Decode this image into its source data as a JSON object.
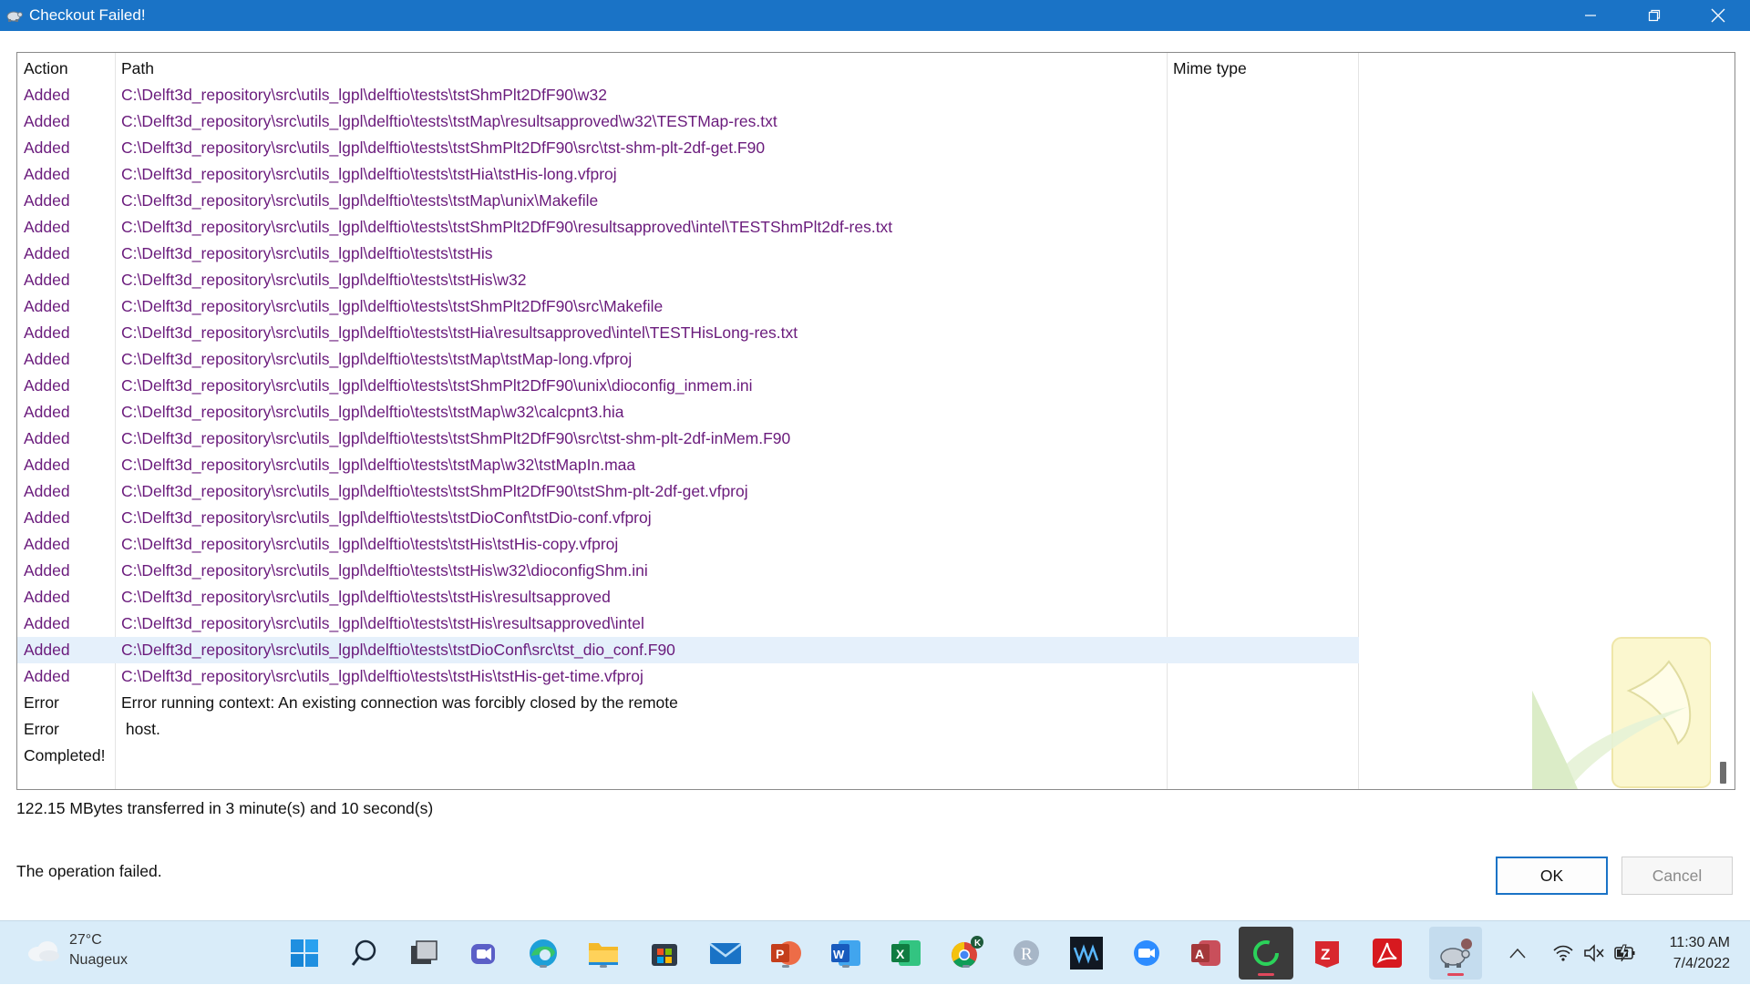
{
  "window": {
    "title": "Checkout Failed!",
    "accent": "#1a73c6"
  },
  "columns": {
    "action": "Action",
    "path": "Path",
    "mime": "Mime type"
  },
  "rows": [
    {
      "action": "Added",
      "path": "C:\\Delft3d_repository\\src\\utils_lgpl\\delftio\\tests\\tstShmPlt2DfF90\\w32"
    },
    {
      "action": "Added",
      "path": "C:\\Delft3d_repository\\src\\utils_lgpl\\delftio\\tests\\tstMap\\resultsapproved\\w32\\TESTMap-res.txt"
    },
    {
      "action": "Added",
      "path": "C:\\Delft3d_repository\\src\\utils_lgpl\\delftio\\tests\\tstShmPlt2DfF90\\src\\tst-shm-plt-2df-get.F90"
    },
    {
      "action": "Added",
      "path": "C:\\Delft3d_repository\\src\\utils_lgpl\\delftio\\tests\\tstHia\\tstHis-long.vfproj"
    },
    {
      "action": "Added",
      "path": "C:\\Delft3d_repository\\src\\utils_lgpl\\delftio\\tests\\tstMap\\unix\\Makefile"
    },
    {
      "action": "Added",
      "path": "C:\\Delft3d_repository\\src\\utils_lgpl\\delftio\\tests\\tstShmPlt2DfF90\\resultsapproved\\intel\\TESTShmPlt2df-res.txt"
    },
    {
      "action": "Added",
      "path": "C:\\Delft3d_repository\\src\\utils_lgpl\\delftio\\tests\\tstHis"
    },
    {
      "action": "Added",
      "path": "C:\\Delft3d_repository\\src\\utils_lgpl\\delftio\\tests\\tstHis\\w32"
    },
    {
      "action": "Added",
      "path": "C:\\Delft3d_repository\\src\\utils_lgpl\\delftio\\tests\\tstShmPlt2DfF90\\src\\Makefile"
    },
    {
      "action": "Added",
      "path": "C:\\Delft3d_repository\\src\\utils_lgpl\\delftio\\tests\\tstHia\\resultsapproved\\intel\\TESTHisLong-res.txt"
    },
    {
      "action": "Added",
      "path": "C:\\Delft3d_repository\\src\\utils_lgpl\\delftio\\tests\\tstMap\\tstMap-long.vfproj"
    },
    {
      "action": "Added",
      "path": "C:\\Delft3d_repository\\src\\utils_lgpl\\delftio\\tests\\tstShmPlt2DfF90\\unix\\dioconfig_inmem.ini"
    },
    {
      "action": "Added",
      "path": "C:\\Delft3d_repository\\src\\utils_lgpl\\delftio\\tests\\tstMap\\w32\\calcpnt3.hia"
    },
    {
      "action": "Added",
      "path": "C:\\Delft3d_repository\\src\\utils_lgpl\\delftio\\tests\\tstShmPlt2DfF90\\src\\tst-shm-plt-2df-inMem.F90"
    },
    {
      "action": "Added",
      "path": "C:\\Delft3d_repository\\src\\utils_lgpl\\delftio\\tests\\tstMap\\w32\\tstMapIn.maa"
    },
    {
      "action": "Added",
      "path": "C:\\Delft3d_repository\\src\\utils_lgpl\\delftio\\tests\\tstShmPlt2DfF90\\tstShm-plt-2df-get.vfproj"
    },
    {
      "action": "Added",
      "path": "C:\\Delft3d_repository\\src\\utils_lgpl\\delftio\\tests\\tstDioConf\\tstDio-conf.vfproj"
    },
    {
      "action": "Added",
      "path": "C:\\Delft3d_repository\\src\\utils_lgpl\\delftio\\tests\\tstHis\\tstHis-copy.vfproj"
    },
    {
      "action": "Added",
      "path": "C:\\Delft3d_repository\\src\\utils_lgpl\\delftio\\tests\\tstHis\\w32\\dioconfigShm.ini"
    },
    {
      "action": "Added",
      "path": "C:\\Delft3d_repository\\src\\utils_lgpl\\delftio\\tests\\tstHis\\resultsapproved"
    },
    {
      "action": "Added",
      "path": "C:\\Delft3d_repository\\src\\utils_lgpl\\delftio\\tests\\tstHis\\resultsapproved\\intel"
    },
    {
      "action": "Added",
      "path": "C:\\Delft3d_repository\\src\\utils_lgpl\\delftio\\tests\\tstDioConf\\src\\tst_dio_conf.F90"
    },
    {
      "action": "Added",
      "path": "C:\\Delft3d_repository\\src\\utils_lgpl\\delftio\\tests\\tstHis\\tstHis-get-time.vfproj"
    },
    {
      "action": "Error",
      "path": "Error running context: An existing connection was forcibly closed by the remote"
    },
    {
      "action": "Error",
      "path": " host."
    },
    {
      "action": "Completed!",
      "path": ""
    }
  ],
  "selected_row": 21,
  "summary": "122.15 MBytes transferred in 3 minute(s) and 10 second(s)",
  "status": "The operation failed.",
  "buttons": {
    "ok": "OK",
    "cancel": "Cancel"
  },
  "taskbar": {
    "weather_temp": "27°C",
    "weather_desc": "Nuageux",
    "time": "11:30 AM",
    "date": "7/4/2022",
    "apps": [
      "start-icon",
      "search-icon",
      "task-view-icon",
      "teams-icon",
      "edge-icon",
      "file-explorer-icon",
      "store-icon",
      "mail-icon",
      "powerpoint-icon",
      "word-icon",
      "excel-icon",
      "chrome-icon",
      "r-icon",
      "waves-icon",
      "zoom-icon",
      "access-icon",
      "loader-icon",
      "z-app-icon",
      "acrobat-icon",
      "tortoise-icon"
    ]
  },
  "colors": {
    "added_text": "#6a1b7c",
    "selected_row": "#e5f0fb",
    "taskbar": "#d9ecf9"
  }
}
